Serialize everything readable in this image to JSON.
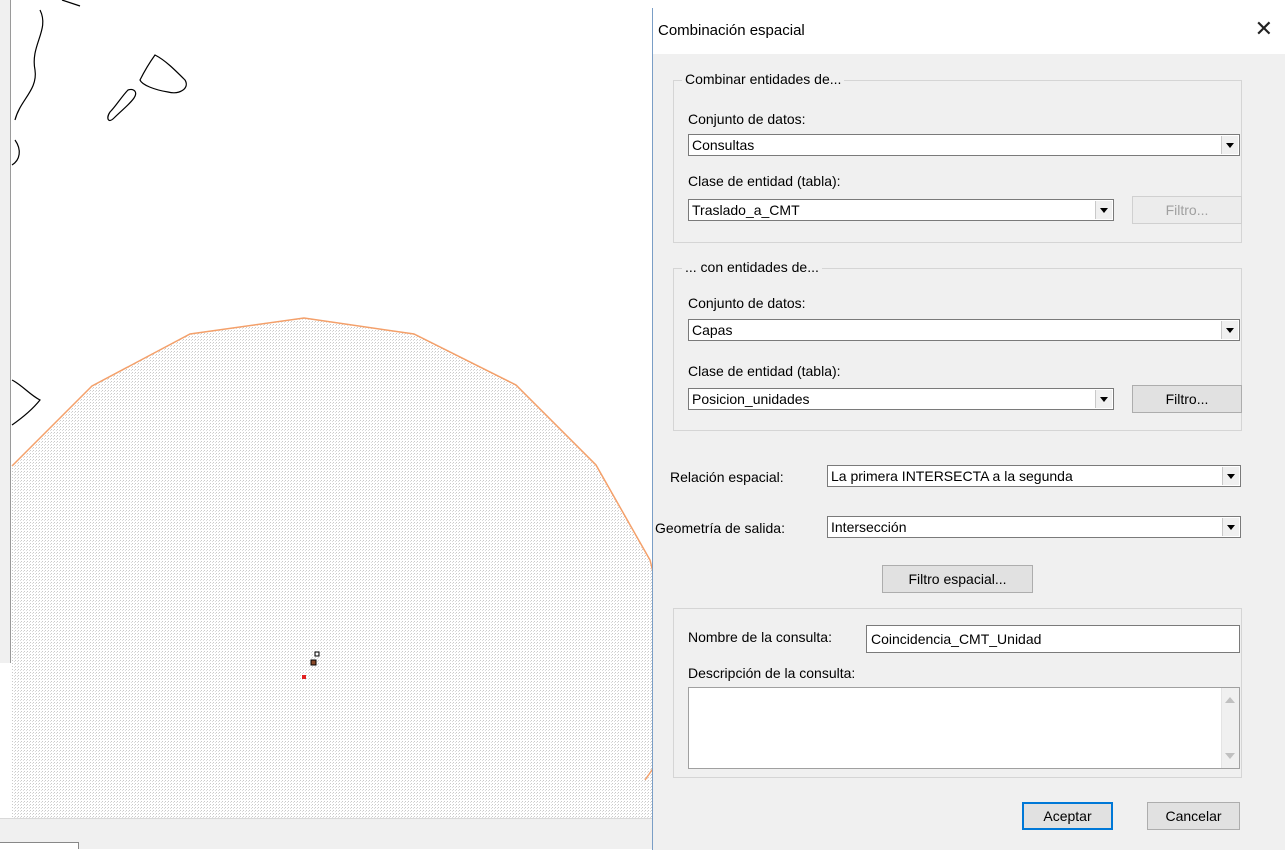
{
  "dialog": {
    "title": "Combinación espacial",
    "close_glyph": "✕",
    "group1": {
      "legend": "Combinar entidades de...",
      "dataset_label": "Conjunto de datos:",
      "dataset_value": "Consultas",
      "class_label": "Clase de entidad (tabla):",
      "class_value": "Traslado_a_CMT",
      "filter_label": "Filtro..."
    },
    "group2": {
      "legend": "... con entidades de...",
      "dataset_label": "Conjunto de datos:",
      "dataset_value": "Capas",
      "class_label": "Clase de entidad (tabla):",
      "class_value": "Posicion_unidades",
      "filter_label": "Filtro..."
    },
    "relation_label": "Relación espacial:",
    "relation_value": "La primera INTERSECTA a la segunda",
    "geometry_label": "Geometría de salida:",
    "geometry_value": "Intersección",
    "spatial_filter_label": "Filtro espacial...",
    "query": {
      "name_label": "Nombre de la consulta:",
      "name_value": "Coincidencia_CMT_Unidad",
      "desc_label": "Descripción de la consulta:",
      "desc_value": ""
    },
    "accept_label": "Aceptar",
    "cancel_label": "Cancelar"
  },
  "colors": {
    "buffer_outline": "#f4a06a",
    "dialog_bg": "#f0f0f0",
    "focus_border": "#0078d7",
    "point_red": "#e02020"
  }
}
